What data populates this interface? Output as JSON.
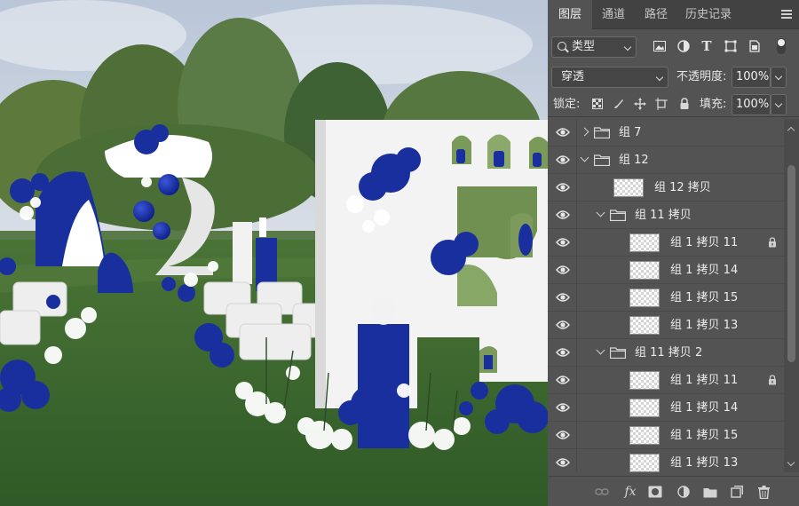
{
  "panel": {
    "tabs": [
      {
        "label": "图层",
        "active": true
      },
      {
        "label": "通道",
        "active": false
      },
      {
        "label": "路径",
        "active": false
      },
      {
        "label": "历史记录",
        "active": false
      }
    ],
    "filter": {
      "label": "类型"
    },
    "blend_mode": "穿透",
    "opacity_label": "不透明度:",
    "opacity_value": "100%",
    "lock_label": "锁定:",
    "fill_label": "填充:",
    "fill_value": "100%"
  },
  "layers": [
    {
      "type": "group",
      "name": "组 7",
      "indent": 0,
      "expanded": false,
      "locked": false
    },
    {
      "type": "group",
      "name": "组 12",
      "indent": 0,
      "expanded": true,
      "locked": false
    },
    {
      "type": "layer",
      "name": "组 12 拷贝",
      "indent": 1,
      "locked": false
    },
    {
      "type": "group",
      "name": "组 11 拷贝",
      "indent": 1,
      "expanded": true,
      "locked": false
    },
    {
      "type": "layer",
      "name": "组 1 拷贝 11",
      "indent": 2,
      "locked": true
    },
    {
      "type": "layer",
      "name": "组 1 拷贝 14",
      "indent": 2,
      "locked": false
    },
    {
      "type": "layer",
      "name": "组 1 拷贝 15",
      "indent": 2,
      "locked": false
    },
    {
      "type": "layer",
      "name": "组 1 拷贝 13",
      "indent": 2,
      "locked": false
    },
    {
      "type": "group",
      "name": "组 11 拷贝 2",
      "indent": 1,
      "expanded": true,
      "locked": false
    },
    {
      "type": "layer",
      "name": "组 1 拷贝 11",
      "indent": 2,
      "locked": true
    },
    {
      "type": "layer",
      "name": "组 1 拷贝 14",
      "indent": 2,
      "locked": false
    },
    {
      "type": "layer",
      "name": "组 1 拷贝 15",
      "indent": 2,
      "locked": false
    },
    {
      "type": "layer",
      "name": "组 1 拷贝 13",
      "indent": 2,
      "locked": false
    }
  ],
  "colors": {
    "panel_bg": "#535353",
    "tab_bar": "#424242",
    "royal_blue": "#1a2f9e",
    "grass": "#3f6a2f"
  },
  "icons": {
    "eye": "eye-icon",
    "folder": "folder-icon",
    "lock": "lock-icon"
  }
}
